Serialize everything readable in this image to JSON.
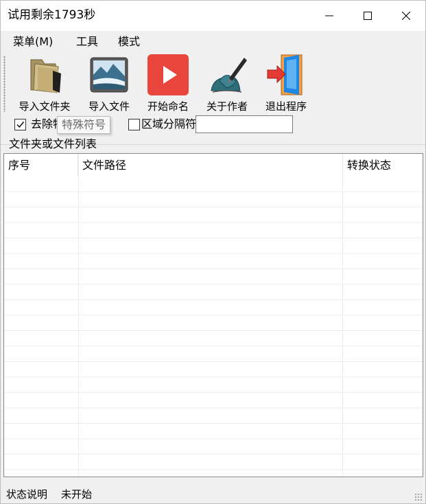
{
  "window": {
    "title": "试用剩余1793秒"
  },
  "menu": [
    "菜单(M)",
    "工具",
    "模式"
  ],
  "toolbar": {
    "items": [
      {
        "label": "导入文件夹",
        "icon": "folder-icon"
      },
      {
        "label": "导入文件",
        "icon": "image-file-icon"
      },
      {
        "label": "开始命名",
        "icon": "play-icon"
      },
      {
        "label": "关于作者",
        "icon": "pen-writing-icon"
      },
      {
        "label": "退出程序",
        "icon": "exit-door-icon"
      }
    ]
  },
  "options": {
    "remove_special_label": "去除特殊符号",
    "remove_special_checked": true,
    "tooltip_text": "特殊符号",
    "separator_label": "区域分隔符",
    "separator_value": ""
  },
  "group": {
    "label": "文件夹或文件列表"
  },
  "table": {
    "columns": [
      "序号",
      "文件路径",
      "转换状态"
    ],
    "rows": []
  },
  "status": {
    "label": "状态说明",
    "value": "未开始"
  },
  "colors": {
    "play_red": "#e8453c",
    "folder_tan": "#c9b27a",
    "door_blue": "#1e88e5"
  }
}
